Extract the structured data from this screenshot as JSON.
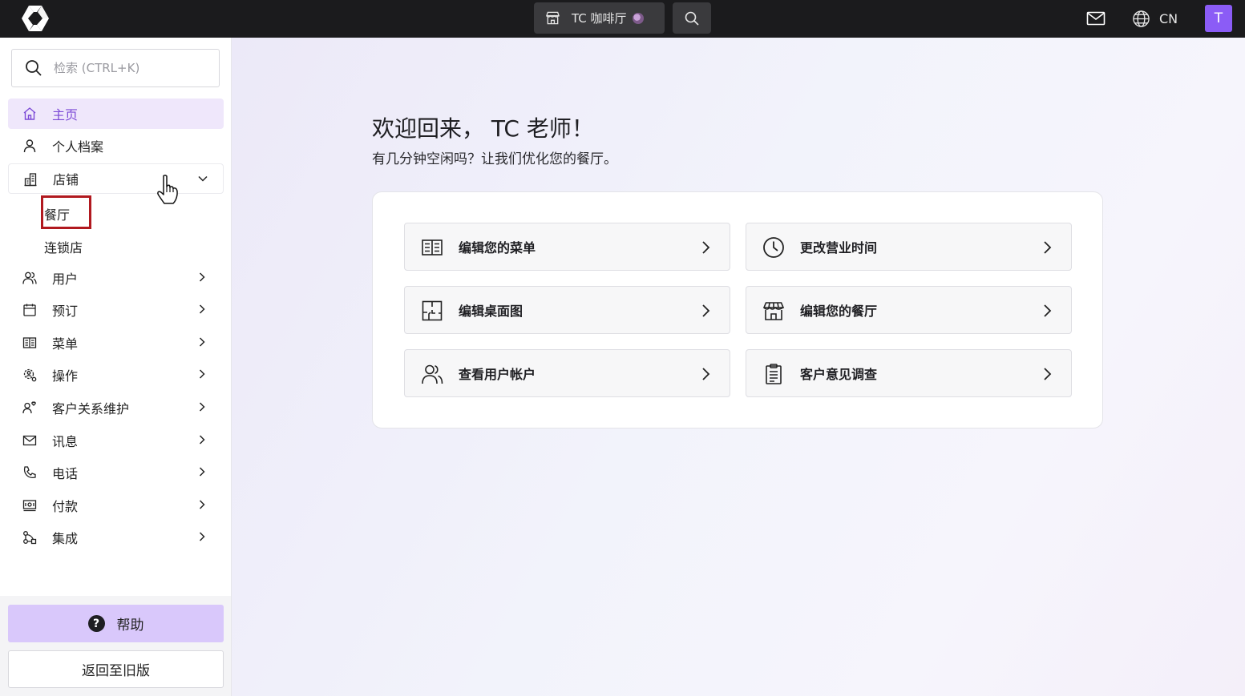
{
  "topbar": {
    "store_name": "TC 咖啡厅",
    "language": "CN",
    "user_initial": "T"
  },
  "sidebar": {
    "search_placeholder": "检索 (CTRL+K)",
    "items": [
      {
        "label": "主页",
        "icon": "home-icon",
        "active": true
      },
      {
        "label": "个人档案",
        "icon": "person-icon"
      },
      {
        "label": "店铺",
        "icon": "building-icon",
        "expanded": true
      },
      {
        "label": "用户",
        "icon": "users-icon"
      },
      {
        "label": "预订",
        "icon": "calendar-icon"
      },
      {
        "label": "菜单",
        "icon": "menu-book-icon"
      },
      {
        "label": "操作",
        "icon": "gear-people-icon"
      },
      {
        "label": "客户关系维护",
        "icon": "customer-heart-icon"
      },
      {
        "label": "讯息",
        "icon": "mail-icon"
      },
      {
        "label": "电话",
        "icon": "phone-icon"
      },
      {
        "label": "付款",
        "icon": "payment-icon"
      },
      {
        "label": "集成",
        "icon": "integration-icon"
      }
    ],
    "subitems": [
      {
        "label": "餐厅",
        "highlighted": true
      },
      {
        "label": "连锁店"
      }
    ],
    "help_label": "帮助",
    "legacy_label": "返回至旧版"
  },
  "main": {
    "greeting": "欢迎回来， TC 老师！",
    "subgreeting": "有几分钟空闲吗？让我们优化您的餐厅。",
    "actions": [
      {
        "label": "编辑您的菜单",
        "icon": "menu-book-icon"
      },
      {
        "label": "更改营业时间",
        "icon": "clock-icon"
      },
      {
        "label": "编辑桌面图",
        "icon": "floorplan-icon"
      },
      {
        "label": "编辑您的餐厅",
        "icon": "storefront-icon"
      },
      {
        "label": "查看用户帐户",
        "icon": "users-icon"
      },
      {
        "label": "客户意见调查",
        "icon": "clipboard-icon"
      }
    ]
  },
  "colors": {
    "topbar": "#1b1b1d",
    "accent": "#8b5cf6",
    "active_bg": "#efe7fb",
    "help_bg": "#d9c8fb",
    "highlight_box": "#b1191f"
  }
}
